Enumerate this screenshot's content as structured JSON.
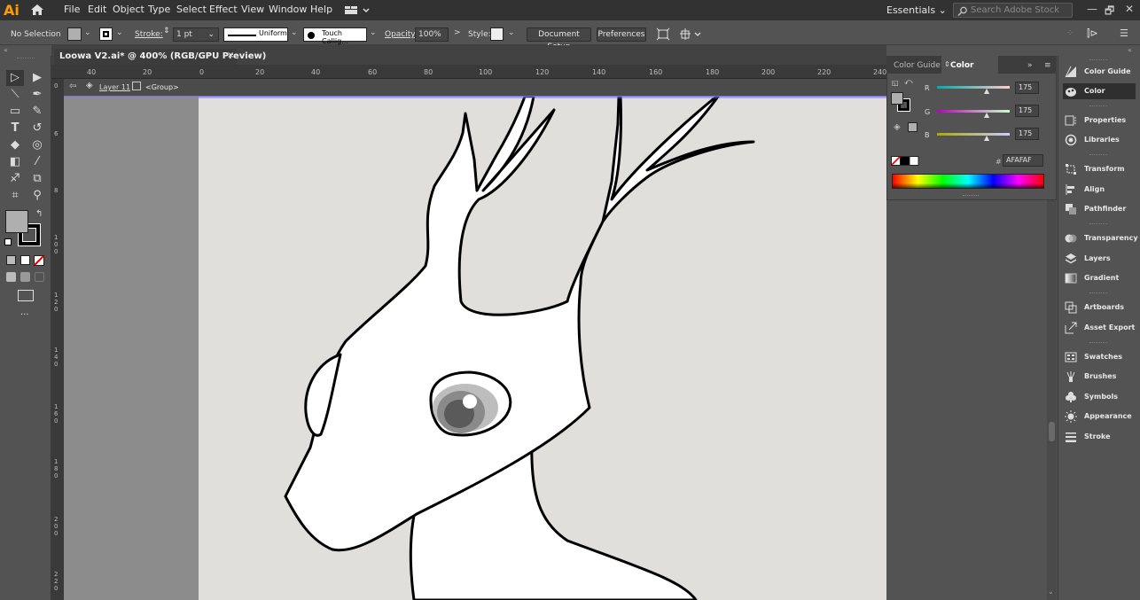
{
  "app": {
    "logo": "Ai"
  },
  "menu": [
    "File",
    "Edit",
    "Object",
    "Type",
    "Select",
    "Effect",
    "View",
    "Window",
    "Help"
  ],
  "workspace": {
    "label": "Essentials"
  },
  "search": {
    "placeholder": "Search Adobe Stock"
  },
  "window_controls": {
    "minimize": "—",
    "restore": "🗗",
    "close": "✕"
  },
  "control_bar": {
    "selection": "No Selection",
    "stroke_label": "Stroke:",
    "stroke_weight": "1 pt",
    "stroke_profile": "Uniform",
    "brush": "Touch Callig...",
    "opacity_label": "Opacity:",
    "opacity_value": "100%",
    "style_label": "Style:",
    "document_setup": "Document Setup",
    "preferences": "Preferences"
  },
  "document": {
    "tab_title": "Loowa V2.ai* @ 400% (RGB/GPU Preview)",
    "close": "×",
    "layer": "Layer 11",
    "group": "<Group>"
  },
  "ruler": {
    "horizontal": [
      "40",
      "20",
      "0",
      "20",
      "40",
      "60",
      "80",
      "100",
      "120",
      "140",
      "160",
      "180",
      "200",
      "220",
      "240"
    ],
    "vertical": [
      "0",
      "6",
      "8",
      "100",
      "120",
      "140",
      "160",
      "180",
      "200",
      "220"
    ]
  },
  "color_panel": {
    "tabs": [
      "Color Guide",
      "Color"
    ],
    "menu": "»",
    "channels": [
      {
        "label": "R",
        "value": "175"
      },
      {
        "label": "G",
        "value": "175"
      },
      {
        "label": "B",
        "value": "175"
      }
    ],
    "hex_label": "#",
    "hex_value": "AFAFAF",
    "fill_color": "#afafaf",
    "stroke_color": "#000000"
  },
  "dock": [
    {
      "label": "Color Guide",
      "icon": "color-guide-icon"
    },
    {
      "label": "Color",
      "icon": "color-icon"
    },
    {
      "label": "Properties",
      "icon": "properties-icon"
    },
    {
      "label": "Libraries",
      "icon": "libraries-icon"
    },
    {
      "label": "Transform",
      "icon": "transform-icon"
    },
    {
      "label": "Align",
      "icon": "align-icon"
    },
    {
      "label": "Pathfinder",
      "icon": "pathfinder-icon"
    },
    {
      "label": "Transparency",
      "icon": "transparency-icon"
    },
    {
      "label": "Layers",
      "icon": "layers-icon"
    },
    {
      "label": "Gradient",
      "icon": "gradient-icon"
    },
    {
      "label": "Artboards",
      "icon": "artboards-icon"
    },
    {
      "label": "Asset Export",
      "icon": "asset-export-icon"
    },
    {
      "label": "Swatches",
      "icon": "swatches-icon"
    },
    {
      "label": "Brushes",
      "icon": "brushes-icon"
    },
    {
      "label": "Symbols",
      "icon": "symbols-icon"
    },
    {
      "label": "Appearance",
      "icon": "appearance-icon"
    },
    {
      "label": "Stroke",
      "icon": "stroke-icon"
    }
  ],
  "colors": {
    "accent": "#ff9a00",
    "selection_line": "#7a6cf0",
    "artboard": "#e0dfdb",
    "pasteboard": "#8c8c8c"
  }
}
